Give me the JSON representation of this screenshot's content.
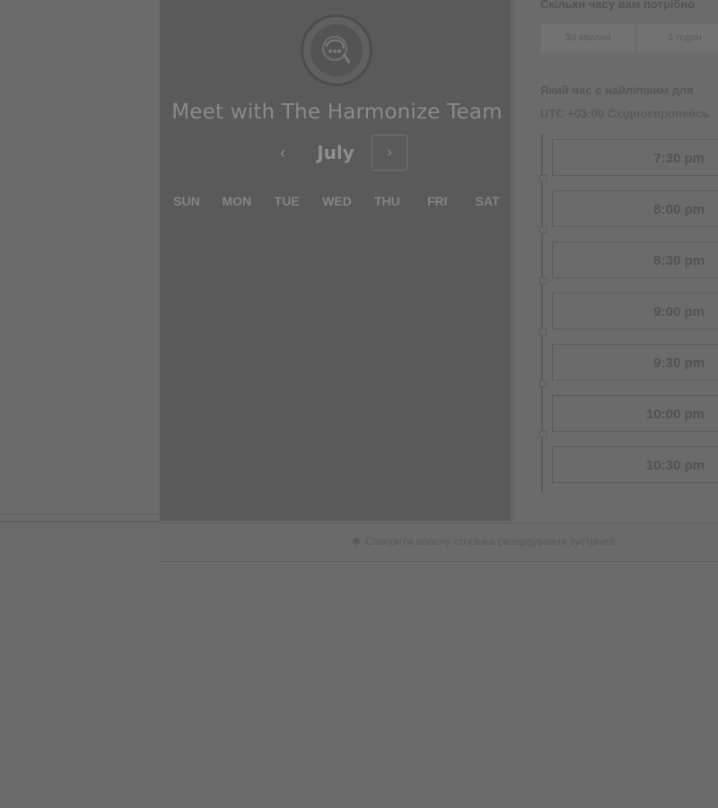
{
  "card": {
    "team_name": "Meet with The Harmonize Team",
    "month": "July",
    "prev_icon": "chevron-left-icon",
    "next_icon": "chevron-right-icon",
    "weekdays": [
      "SUN",
      "MON",
      "TUE",
      "WED",
      "THU",
      "FRI",
      "SAT"
    ]
  },
  "booking": {
    "duration_title": "Скільки часу вам потрібно",
    "duration_options": [
      "30 хвилин",
      "1 годин"
    ],
    "best_time_title": "Який час є найліпшим для",
    "timezone": "UTC +03:00 Східноєвропейсь",
    "slots": [
      "7:30 pm",
      "8:00 pm",
      "8:30 pm",
      "9:00 pm",
      "9:30 pm",
      "10:00 pm",
      "10:30 pm"
    ]
  },
  "footer": {
    "link_label": "Створити власну сторінка резервування зустрічей"
  }
}
